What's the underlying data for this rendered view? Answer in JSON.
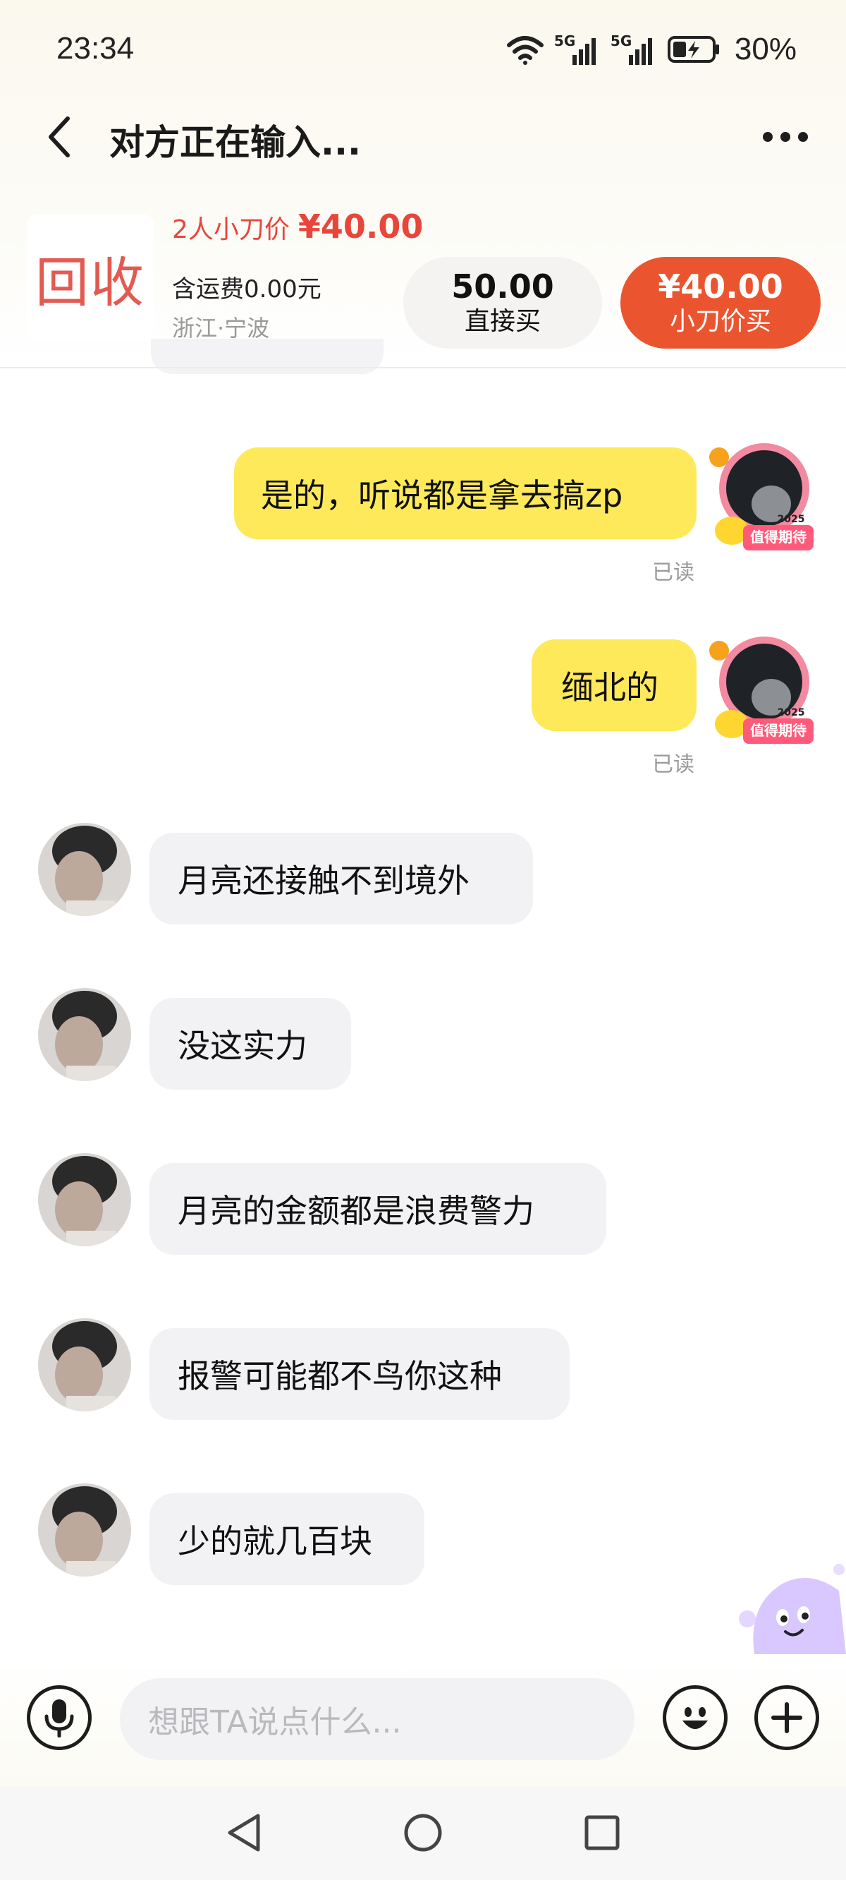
{
  "status_bar": {
    "time": "23:34",
    "battery": "30%",
    "signal1_label": "5G",
    "signal2_label": "5G",
    "icons": [
      "wifi-icon",
      "signal-5g-icon",
      "signal-5g-icon",
      "battery-charging-icon"
    ]
  },
  "header": {
    "title": "对方正在输入...",
    "back_icon": "chevron-left-icon",
    "more_icon": "more-horizontal-icon"
  },
  "product": {
    "thumb_text": "回收",
    "price_label": "2人小刀价",
    "price_value": "¥40.00",
    "shipping": "含运费0.00元",
    "location": "浙江·宁波",
    "direct_buy_price": "50.00",
    "direct_buy_label": "直接买",
    "cut_buy_price": "¥40.00",
    "cut_buy_label": "小刀价买"
  },
  "messages": [
    {
      "side": "me",
      "text": "是的，听说都是拿去搞zp",
      "status": "已读",
      "badge": "2025",
      "badge_text": "值得期待"
    },
    {
      "side": "me",
      "text": "缅北的",
      "status": "已读",
      "badge": "2025",
      "badge_text": "值得期待"
    },
    {
      "side": "them",
      "text": "月亮还接触不到境外"
    },
    {
      "side": "them",
      "text": "没这实力"
    },
    {
      "side": "them",
      "text": "月亮的金额都是浪费警力"
    },
    {
      "side": "them",
      "text": "报警可能都不鸟你这种"
    },
    {
      "side": "them",
      "text": "少的就几百块"
    }
  ],
  "input_bar": {
    "placeholder": "想跟TA说点什么...",
    "icons": [
      "microphone-icon",
      "emoji-icon",
      "plus-icon"
    ]
  },
  "nav_bar": {
    "icons": [
      "nav-back-icon",
      "nav-home-icon",
      "nav-recents-icon"
    ]
  },
  "colors": {
    "accent_red": "#e8463a",
    "buy_button": "#ea5530",
    "bubble_out": "#fde95a",
    "bubble_in": "#f2f2f4"
  }
}
